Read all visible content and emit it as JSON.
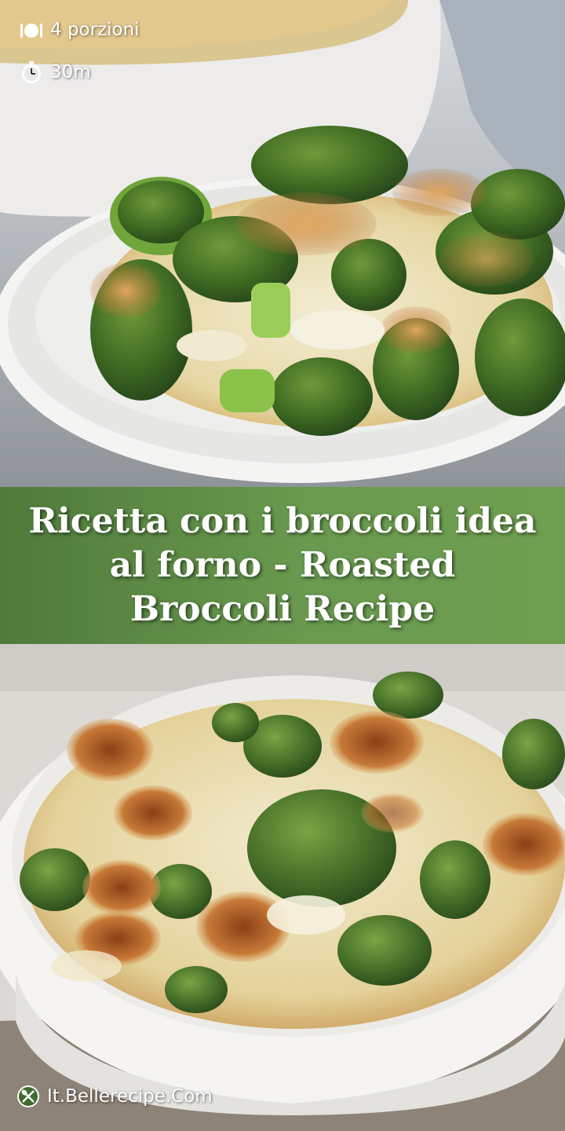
{
  "servings": {
    "icon": "plate-cutlery-icon",
    "text": "4 porzioni"
  },
  "time": {
    "icon": "stopwatch-icon",
    "text": "30m"
  },
  "banner": {
    "title": "Ricetta con i broccoli idea al forno - Roasted Broccoli Recipe",
    "background": "#5f8d45",
    "text_color": "#ffffff"
  },
  "footer": {
    "logo_icon": "whisk-spoon-logo-icon",
    "site": "It.Bellerecipe.Com"
  },
  "photos": {
    "top": "broccoli gratin on a white plate",
    "bottom": "broccoli gratin in white baking dish"
  }
}
